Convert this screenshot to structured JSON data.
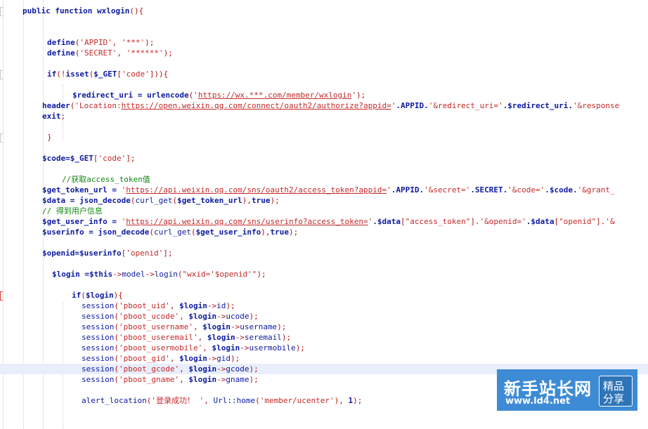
{
  "editor": {
    "highlight_line": 34,
    "lines": [
      [
        {
          "t": "public function wxlogin",
          "c": "k"
        },
        {
          "t": "(){",
          "c": "o"
        }
      ],
      [],
      [],
      [
        {
          "t": "define",
          "c": "k"
        },
        {
          "t": "(",
          "c": "o"
        },
        {
          "t": "'APPID'",
          "c": "s"
        },
        {
          "t": ", ",
          "c": "o"
        },
        {
          "t": "'***'",
          "c": "s"
        },
        {
          "t": ");",
          "c": "o"
        }
      ],
      [
        {
          "t": "define",
          "c": "k"
        },
        {
          "t": "(",
          "c": "o"
        },
        {
          "t": "'SECRET'",
          "c": "s"
        },
        {
          "t": ", ",
          "c": "o"
        },
        {
          "t": "'******'",
          "c": "s"
        },
        {
          "t": ");",
          "c": "o"
        }
      ],
      [],
      [
        {
          "t": "if",
          "c": "k"
        },
        {
          "t": "(!",
          "c": "o"
        },
        {
          "t": "isset",
          "c": "k"
        },
        {
          "t": "(",
          "c": "o"
        },
        {
          "t": "$_GET",
          "c": "k"
        },
        {
          "t": "[",
          "c": "o"
        },
        {
          "t": "'code'",
          "c": "s"
        },
        {
          "t": "])){",
          "c": "o"
        }
      ],
      [],
      [
        {
          "t": "$redirect_uri = urlencode",
          "c": "k"
        },
        {
          "t": "(",
          "c": "o"
        },
        {
          "t": "'",
          "c": "s"
        },
        {
          "t": "https://wx.***.com/member/wxlogin",
          "c": "u"
        },
        {
          "t": "'",
          "c": "s"
        },
        {
          "t": ");",
          "c": "o"
        }
      ],
      [
        {
          "t": "header",
          "c": "k"
        },
        {
          "t": "(",
          "c": "o"
        },
        {
          "t": "'Location:",
          "c": "s"
        },
        {
          "t": "https://open.weixin.qq.com/connect/oauth2/authorize?appid=",
          "c": "u"
        },
        {
          "t": "'",
          "c": "s"
        },
        {
          "t": ".APPID.",
          "c": "k"
        },
        {
          "t": "'&redirect_uri='",
          "c": "s"
        },
        {
          "t": ".$redirect_uri.",
          "c": "k"
        },
        {
          "t": "'&response",
          "c": "s"
        }
      ],
      [
        {
          "t": "exit",
          "c": "k"
        },
        {
          "t": ";",
          "c": "o"
        }
      ],
      [],
      [
        {
          "t": "}",
          "c": "o"
        }
      ],
      [],
      [
        {
          "t": "$code=$_GET",
          "c": "k"
        },
        {
          "t": "[",
          "c": "o"
        },
        {
          "t": "'code'",
          "c": "s"
        },
        {
          "t": "];",
          "c": "o"
        }
      ],
      [],
      [
        {
          "t": "//获取access_token值",
          "c": "c"
        }
      ],
      [
        {
          "t": "$get_token_url = ",
          "c": "k"
        },
        {
          "t": "'",
          "c": "s"
        },
        {
          "t": "https://api.weixin.qq.com/sns/oauth2/access_token?appid=",
          "c": "u"
        },
        {
          "t": "'",
          "c": "s"
        },
        {
          "t": ".APPID.",
          "c": "k"
        },
        {
          "t": "'&secret='",
          "c": "s"
        },
        {
          "t": ".SECRET.",
          "c": "k"
        },
        {
          "t": "'&code='",
          "c": "s"
        },
        {
          "t": ".$code.",
          "c": "k"
        },
        {
          "t": "'&grant_",
          "c": "s"
        }
      ],
      [
        {
          "t": "$data = json_decode",
          "c": "k"
        },
        {
          "t": "(",
          "c": "o"
        },
        {
          "t": "curl_get",
          "c": "v"
        },
        {
          "t": "(",
          "c": "o"
        },
        {
          "t": "$get_token_url",
          "c": "k"
        },
        {
          "t": "),",
          "c": "o"
        },
        {
          "t": "true",
          "c": "k"
        },
        {
          "t": ");",
          "c": "o"
        }
      ],
      [
        {
          "t": "// 得到用户信息",
          "c": "c"
        }
      ],
      [
        {
          "t": "$get_user_info = ",
          "c": "k"
        },
        {
          "t": "'",
          "c": "s"
        },
        {
          "t": "https://api.weixin.qq.com/sns/userinfo?access_token=",
          "c": "u"
        },
        {
          "t": "'",
          "c": "s"
        },
        {
          "t": ".$data",
          "c": "k"
        },
        {
          "t": "[",
          "c": "o"
        },
        {
          "t": "\"access_token\"",
          "c": "s"
        },
        {
          "t": "].",
          "c": "o"
        },
        {
          "t": "'&openid='",
          "c": "s"
        },
        {
          "t": ".$data",
          "c": "k"
        },
        {
          "t": "[",
          "c": "o"
        },
        {
          "t": "\"openid\"",
          "c": "s"
        },
        {
          "t": "].",
          "c": "o"
        },
        {
          "t": "'&",
          "c": "s"
        }
      ],
      [
        {
          "t": "$userinfo = json_decode",
          "c": "k"
        },
        {
          "t": "(",
          "c": "o"
        },
        {
          "t": "curl_get",
          "c": "v"
        },
        {
          "t": "(",
          "c": "o"
        },
        {
          "t": "$get_user_info",
          "c": "k"
        },
        {
          "t": "),",
          "c": "o"
        },
        {
          "t": "true",
          "c": "k"
        },
        {
          "t": ");",
          "c": "o"
        }
      ],
      [],
      [
        {
          "t": "$openid=$userinfo",
          "c": "k"
        },
        {
          "t": "[",
          "c": "o"
        },
        {
          "t": "'openid'",
          "c": "s"
        },
        {
          "t": "];",
          "c": "o"
        }
      ],
      [],
      [
        {
          "t": "$login =$this",
          "c": "k"
        },
        {
          "t": "->",
          "c": "o"
        },
        {
          "t": "model",
          "c": "v"
        },
        {
          "t": "->",
          "c": "o"
        },
        {
          "t": "login",
          "c": "v"
        },
        {
          "t": "(",
          "c": "o"
        },
        {
          "t": "\"wxid='$openid'\"",
          "c": "s"
        },
        {
          "t": ");",
          "c": "o"
        }
      ],
      [],
      [
        {
          "t": "if",
          "c": "k"
        },
        {
          "t": "(",
          "c": "o"
        },
        {
          "t": "$login",
          "c": "k"
        },
        {
          "t": "){",
          "c": "o"
        }
      ],
      [
        {
          "t": "session",
          "c": "v"
        },
        {
          "t": "(",
          "c": "o"
        },
        {
          "t": "'pboot_uid'",
          "c": "s"
        },
        {
          "t": ", ",
          "c": "o"
        },
        {
          "t": "$login",
          "c": "k"
        },
        {
          "t": "->",
          "c": "o"
        },
        {
          "t": "id",
          "c": "v"
        },
        {
          "t": ");",
          "c": "o"
        }
      ],
      [
        {
          "t": "session",
          "c": "v"
        },
        {
          "t": "(",
          "c": "o"
        },
        {
          "t": "'pboot_ucode'",
          "c": "s"
        },
        {
          "t": ", ",
          "c": "o"
        },
        {
          "t": "$login",
          "c": "k"
        },
        {
          "t": "->",
          "c": "o"
        },
        {
          "t": "ucode",
          "c": "v"
        },
        {
          "t": ");",
          "c": "o"
        }
      ],
      [
        {
          "t": "session",
          "c": "v"
        },
        {
          "t": "(",
          "c": "o"
        },
        {
          "t": "'pboot_username'",
          "c": "s"
        },
        {
          "t": ", ",
          "c": "o"
        },
        {
          "t": "$login",
          "c": "k"
        },
        {
          "t": "->",
          "c": "o"
        },
        {
          "t": "username",
          "c": "v"
        },
        {
          "t": ");",
          "c": "o"
        }
      ],
      [
        {
          "t": "session",
          "c": "v"
        },
        {
          "t": "(",
          "c": "o"
        },
        {
          "t": "'pboot_useremail'",
          "c": "s"
        },
        {
          "t": ", ",
          "c": "o"
        },
        {
          "t": "$login",
          "c": "k"
        },
        {
          "t": "->",
          "c": "o"
        },
        {
          "t": "seremail",
          "c": "v"
        },
        {
          "t": ");",
          "c": "o"
        }
      ],
      [
        {
          "t": "session",
          "c": "v"
        },
        {
          "t": "(",
          "c": "o"
        },
        {
          "t": "'pboot_usermobile'",
          "c": "s"
        },
        {
          "t": ", ",
          "c": "o"
        },
        {
          "t": "$login",
          "c": "k"
        },
        {
          "t": "->",
          "c": "o"
        },
        {
          "t": "usermobile",
          "c": "v"
        },
        {
          "t": ");",
          "c": "o"
        }
      ],
      [
        {
          "t": "session",
          "c": "v"
        },
        {
          "t": "(",
          "c": "o"
        },
        {
          "t": "'pboot_gid'",
          "c": "s"
        },
        {
          "t": ", ",
          "c": "o"
        },
        {
          "t": "$login",
          "c": "k"
        },
        {
          "t": "->",
          "c": "o"
        },
        {
          "t": "gid",
          "c": "v"
        },
        {
          "t": ");",
          "c": "o"
        }
      ],
      [
        {
          "t": "session",
          "c": "v"
        },
        {
          "t": "(",
          "c": "o"
        },
        {
          "t": "'pboot_gcode'",
          "c": "s"
        },
        {
          "t": ", ",
          "c": "o"
        },
        {
          "t": "$login",
          "c": "k"
        },
        {
          "t": "->",
          "c": "o"
        },
        {
          "t": "gcode",
          "c": "v"
        },
        {
          "t": ");",
          "c": "o"
        }
      ],
      [
        {
          "t": "session",
          "c": "v"
        },
        {
          "t": "(",
          "c": "o"
        },
        {
          "t": "'pboot_gname'",
          "c": "s"
        },
        {
          "t": ", ",
          "c": "o"
        },
        {
          "t": "$login",
          "c": "k"
        },
        {
          "t": "->",
          "c": "o"
        },
        {
          "t": "gname",
          "c": "v"
        },
        {
          "t": ");",
          "c": "o"
        }
      ],
      [],
      [
        {
          "t": "alert_location",
          "c": "v"
        },
        {
          "t": "(",
          "c": "o"
        },
        {
          "t": "'登录成功！ '",
          "c": "s"
        },
        {
          "t": ", ",
          "c": "o"
        },
        {
          "t": "Url::home",
          "c": "v"
        },
        {
          "t": "(",
          "c": "o"
        },
        {
          "t": "'member/ucenter'",
          "c": "s"
        },
        {
          "t": "), ",
          "c": "o"
        },
        {
          "t": "1",
          "c": "k"
        },
        {
          "t": ");",
          "c": "o"
        }
      ]
    ]
  },
  "watermark": {
    "title": "新手站长网",
    "url": "www.ld4.net",
    "badge_top": "精品",
    "badge_bottom": "分享"
  }
}
